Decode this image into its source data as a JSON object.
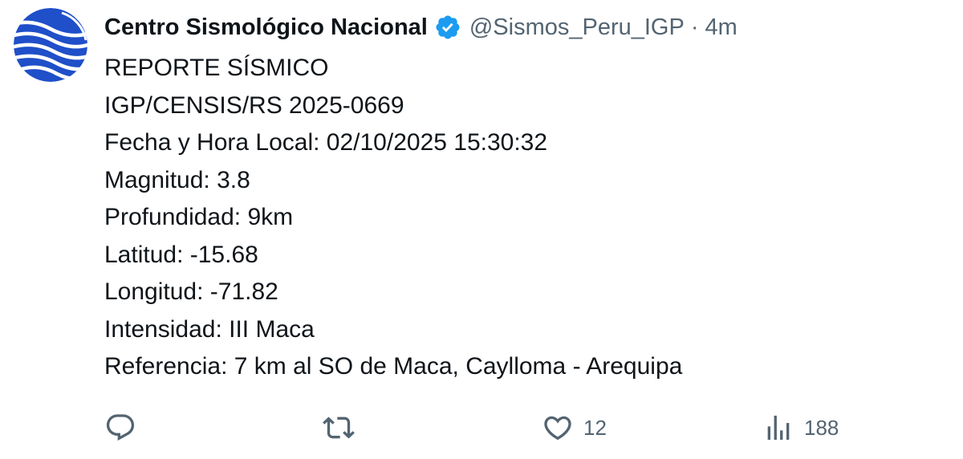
{
  "account": {
    "display_name": "Centro Sismológico Nacional",
    "handle": "@Sismos_Peru_IGP",
    "separator": "·",
    "time": "4m",
    "verified": true,
    "avatar_icon": "igp-logo-icon"
  },
  "tweet": {
    "lines": [
      "REPORTE SÍSMICO",
      "IGP/CENSIS/RS 2025-0669",
      "Fecha y Hora Local: 02/10/2025 15:30:32",
      "Magnitud: 3.8",
      "Profundidad: 9km",
      "Latitud: -15.68",
      "Longitud: -71.82",
      "Intensidad: III Maca",
      "Referencia: 7 km al SO de Maca, Caylloma - Arequipa"
    ]
  },
  "actions": {
    "reply": {
      "icon": "reply-icon",
      "count": ""
    },
    "retweet": {
      "icon": "retweet-icon",
      "count": ""
    },
    "like": {
      "icon": "heart-icon",
      "count": "12"
    },
    "views": {
      "icon": "views-icon",
      "count": "188"
    }
  },
  "colors": {
    "text": "#0f1419",
    "secondary": "#536471",
    "verified_badge": "#1d9bf0",
    "avatar_blue": "#1f4fc9"
  }
}
